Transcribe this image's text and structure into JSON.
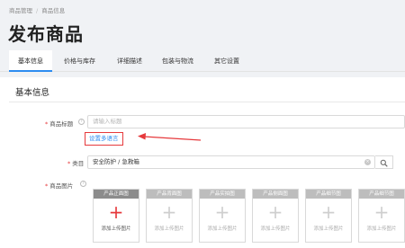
{
  "breadcrumb": [
    "商品管理",
    "商品信息"
  ],
  "page_title": "发布商品",
  "tabs": [
    "基本信息",
    "价格与库存",
    "详细描述",
    "包装与物流",
    "其它设置"
  ],
  "section_title": "基本信息",
  "product_title": {
    "label": "商品标题",
    "placeholder": "请输入标题",
    "multilang_link": "设置多语言"
  },
  "category": {
    "label": "类目",
    "value": "安全防护 / 急救箱"
  },
  "product_images": {
    "label": "商品图片",
    "slots": [
      {
        "title": "产品正面图",
        "caption": "添加上传图片"
      },
      {
        "title": "产品背面图",
        "caption": "添加上传图片"
      },
      {
        "title": "产品实拍图",
        "caption": "添加上传图片"
      },
      {
        "title": "产品侧面图",
        "caption": "添加上传图片"
      },
      {
        "title": "产品细节图",
        "caption": "添加上传图片"
      },
      {
        "title": "产品细节图",
        "caption": "添加上传图片"
      }
    ]
  },
  "colors": {
    "required": "#e6393c",
    "link": "#2d8cf0",
    "annotation_arrow": "#e6393c"
  },
  "icons": {
    "help": "help-circle-icon",
    "clear": "clear-circle-icon",
    "search": "search-icon",
    "upload": "plus-icon"
  }
}
